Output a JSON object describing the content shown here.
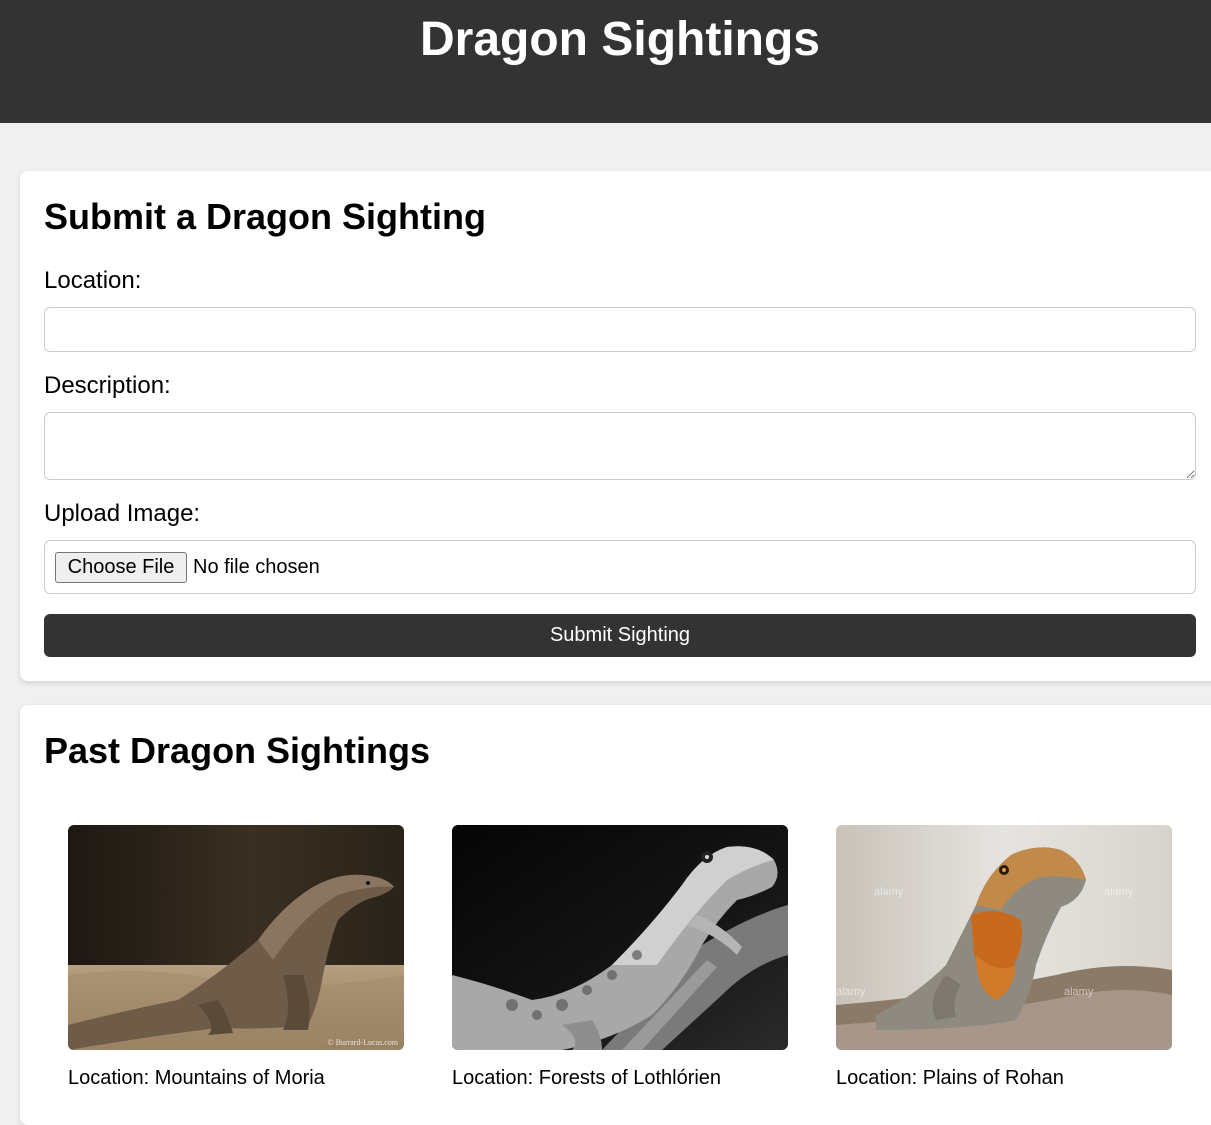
{
  "header": {
    "title": "Dragon Sightings"
  },
  "form": {
    "heading": "Submit a Dragon Sighting",
    "location_label": "Location:",
    "location_value": "",
    "description_label": "Description:",
    "description_value": "",
    "upload_label": "Upload Image:",
    "file_button": "Choose File",
    "file_status": "No file chosen",
    "submit_label": "Submit Sighting"
  },
  "past": {
    "heading": "Past Dragon Sightings",
    "items": [
      {
        "location": "Location: Mountains of Moria",
        "image": "komodo-dragon-photo",
        "watermark": "© Burrard-Lucas.com"
      },
      {
        "location": "Location: Forests of Lothlórien",
        "image": "bearded-dragon-bw-photo"
      },
      {
        "location": "Location: Plains of Rohan",
        "image": "bearded-dragon-color-photo",
        "watermark": "alamy"
      }
    ]
  },
  "colors": {
    "header_bg": "#333333",
    "page_bg": "#f0f0f0",
    "button_bg": "#333333",
    "card_bg": "#ffffff"
  }
}
